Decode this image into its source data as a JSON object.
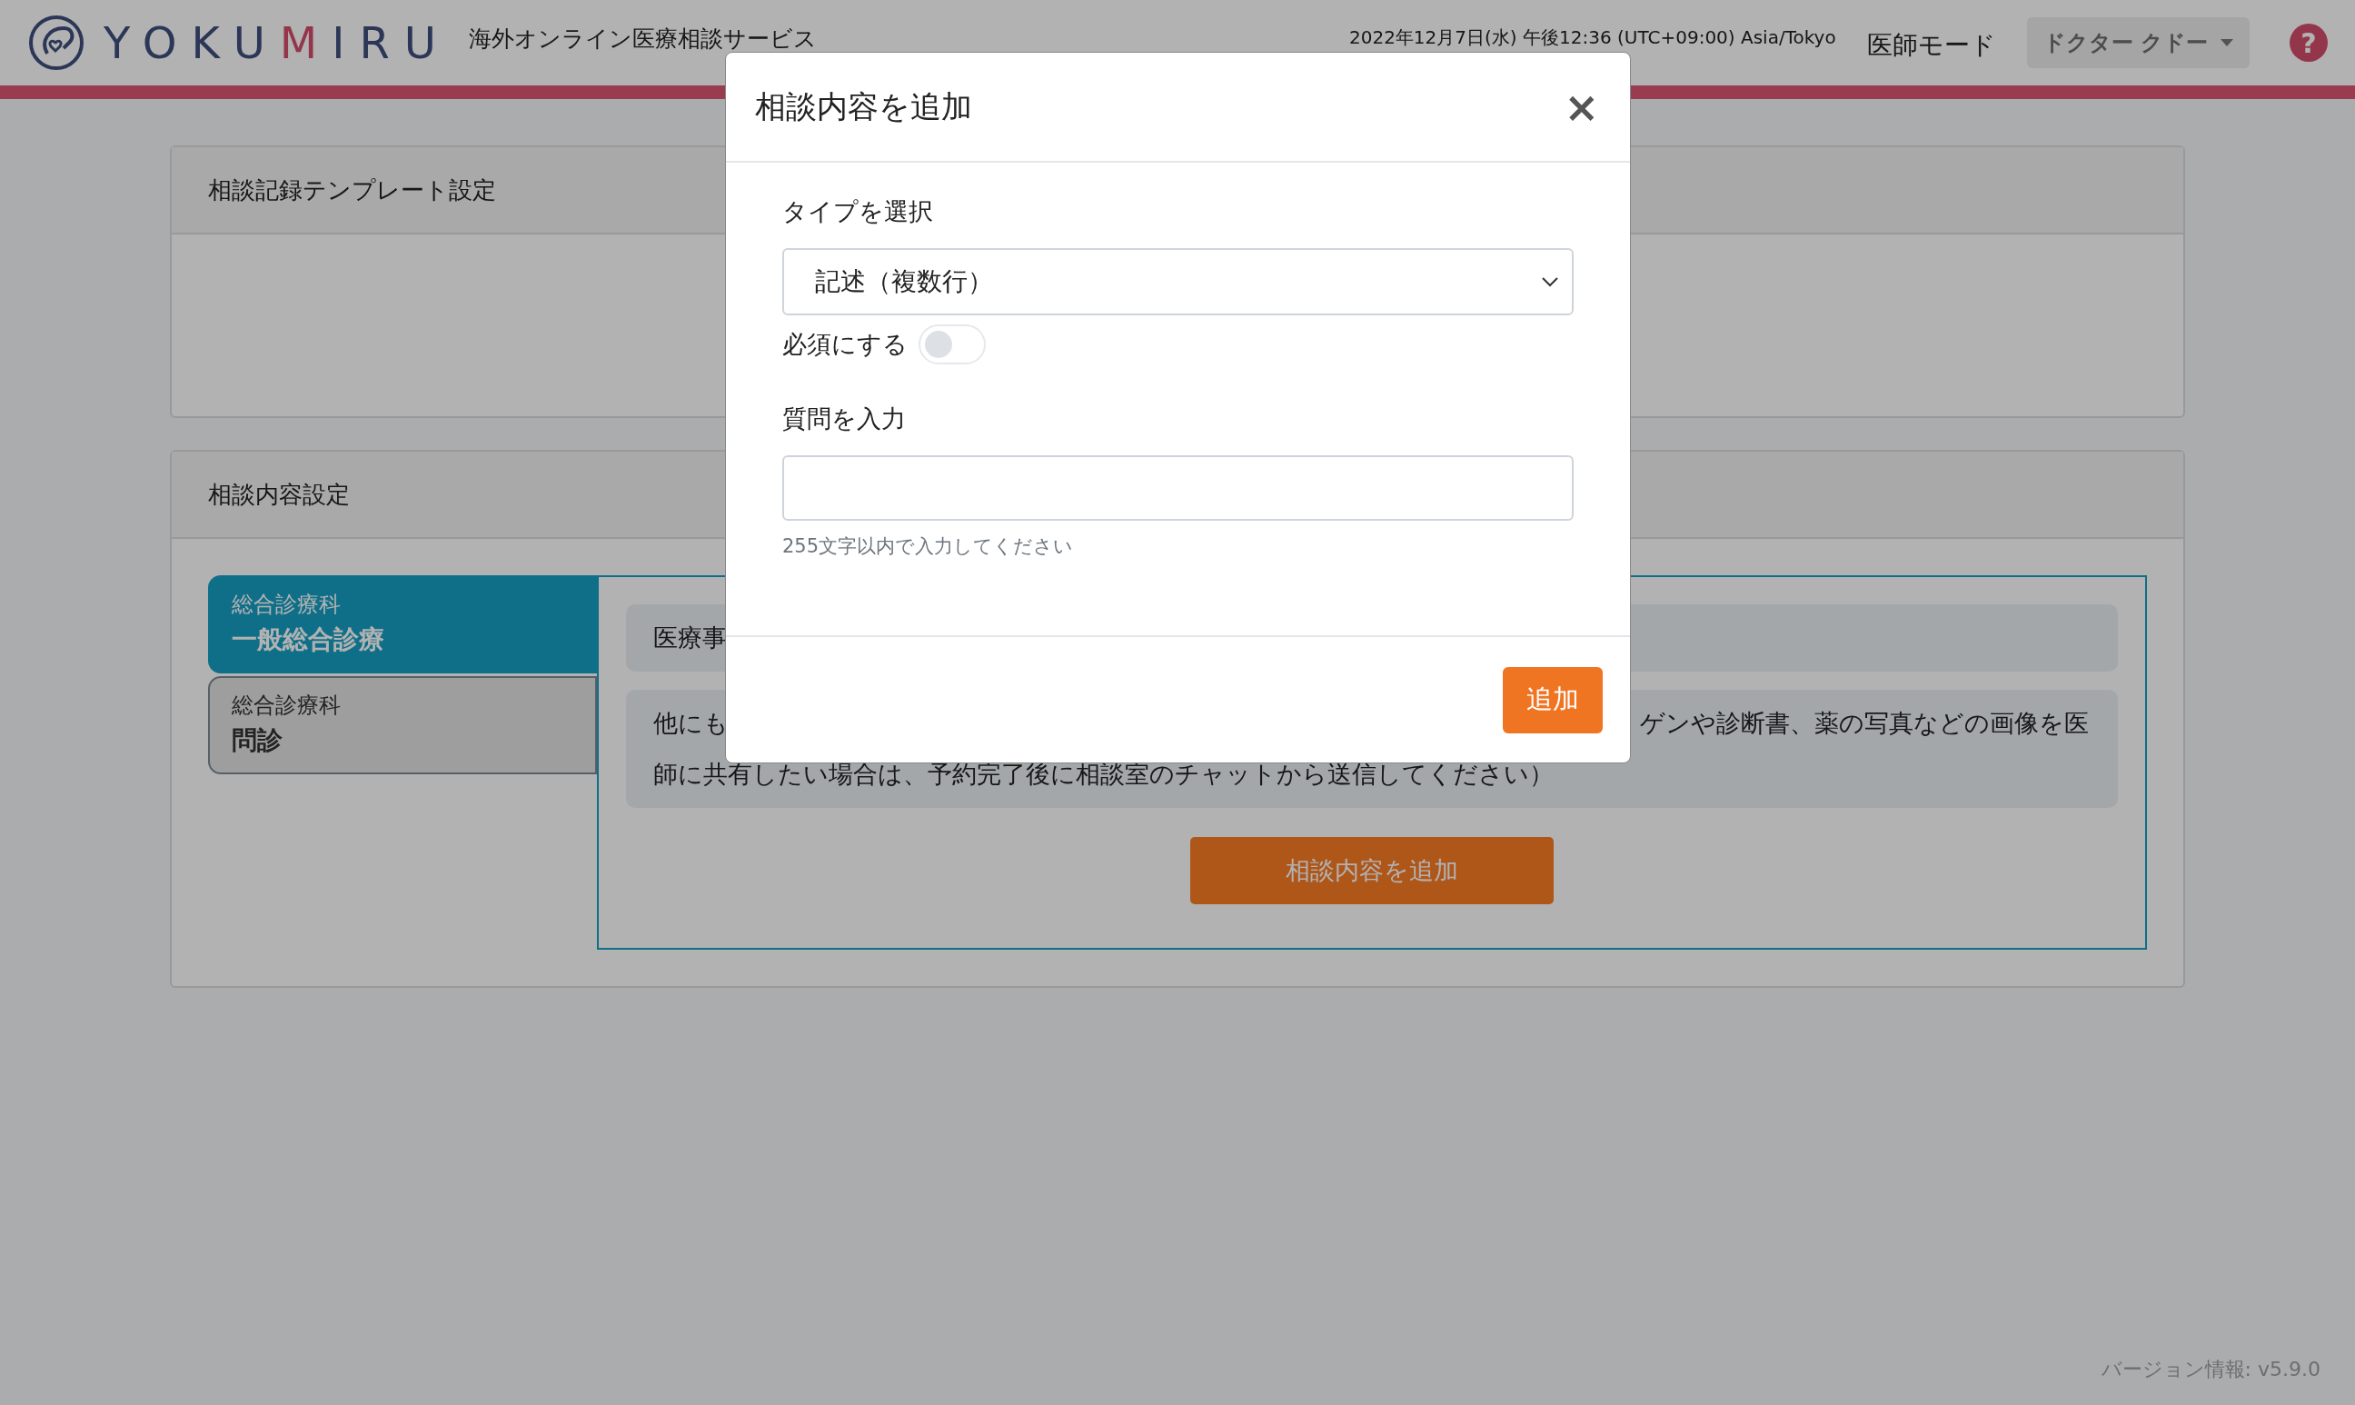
{
  "header": {
    "logo_text": "YOKUMIRU",
    "service_name": "海外オンライン医療相談サービス",
    "datetime": "2022年12月7日(水) 午後12:36 (UTC+09:00) Asia/Tokyo",
    "mode": "医師モード",
    "user_menu": "ドクター クドー",
    "help": "?"
  },
  "template_card": {
    "title": "相談記録テンプレート設定"
  },
  "content_card": {
    "title": "相談内容設定",
    "tabs": [
      {
        "category": "総合診療科",
        "name": "一般総合診療",
        "selected": true
      },
      {
        "category": "総合診療科",
        "name": "問診",
        "selected": false
      }
    ],
    "items": [
      {
        "lines": [
          [
            "医療事"
          ]
        ]
      },
      {
        "lines": [
          [
            "他にも",
            "ゲンや診断書、薬の写真などの画像を医"
          ],
          [
            "師に共有したい場合は、予約完了後に相談室のチャットから送信してください）"
          ]
        ]
      }
    ],
    "add_button": "相談内容を追加"
  },
  "modal": {
    "title": "相談内容を追加",
    "close": "×",
    "type_label": "タイプを選択",
    "type_value": "記述（複数行）",
    "required_label": "必須にする",
    "required": false,
    "question_label": "質問を入力",
    "hint": "255文字以内で入力してください",
    "submit": "追加"
  },
  "version": "バージョン情報: v5.9.0"
}
